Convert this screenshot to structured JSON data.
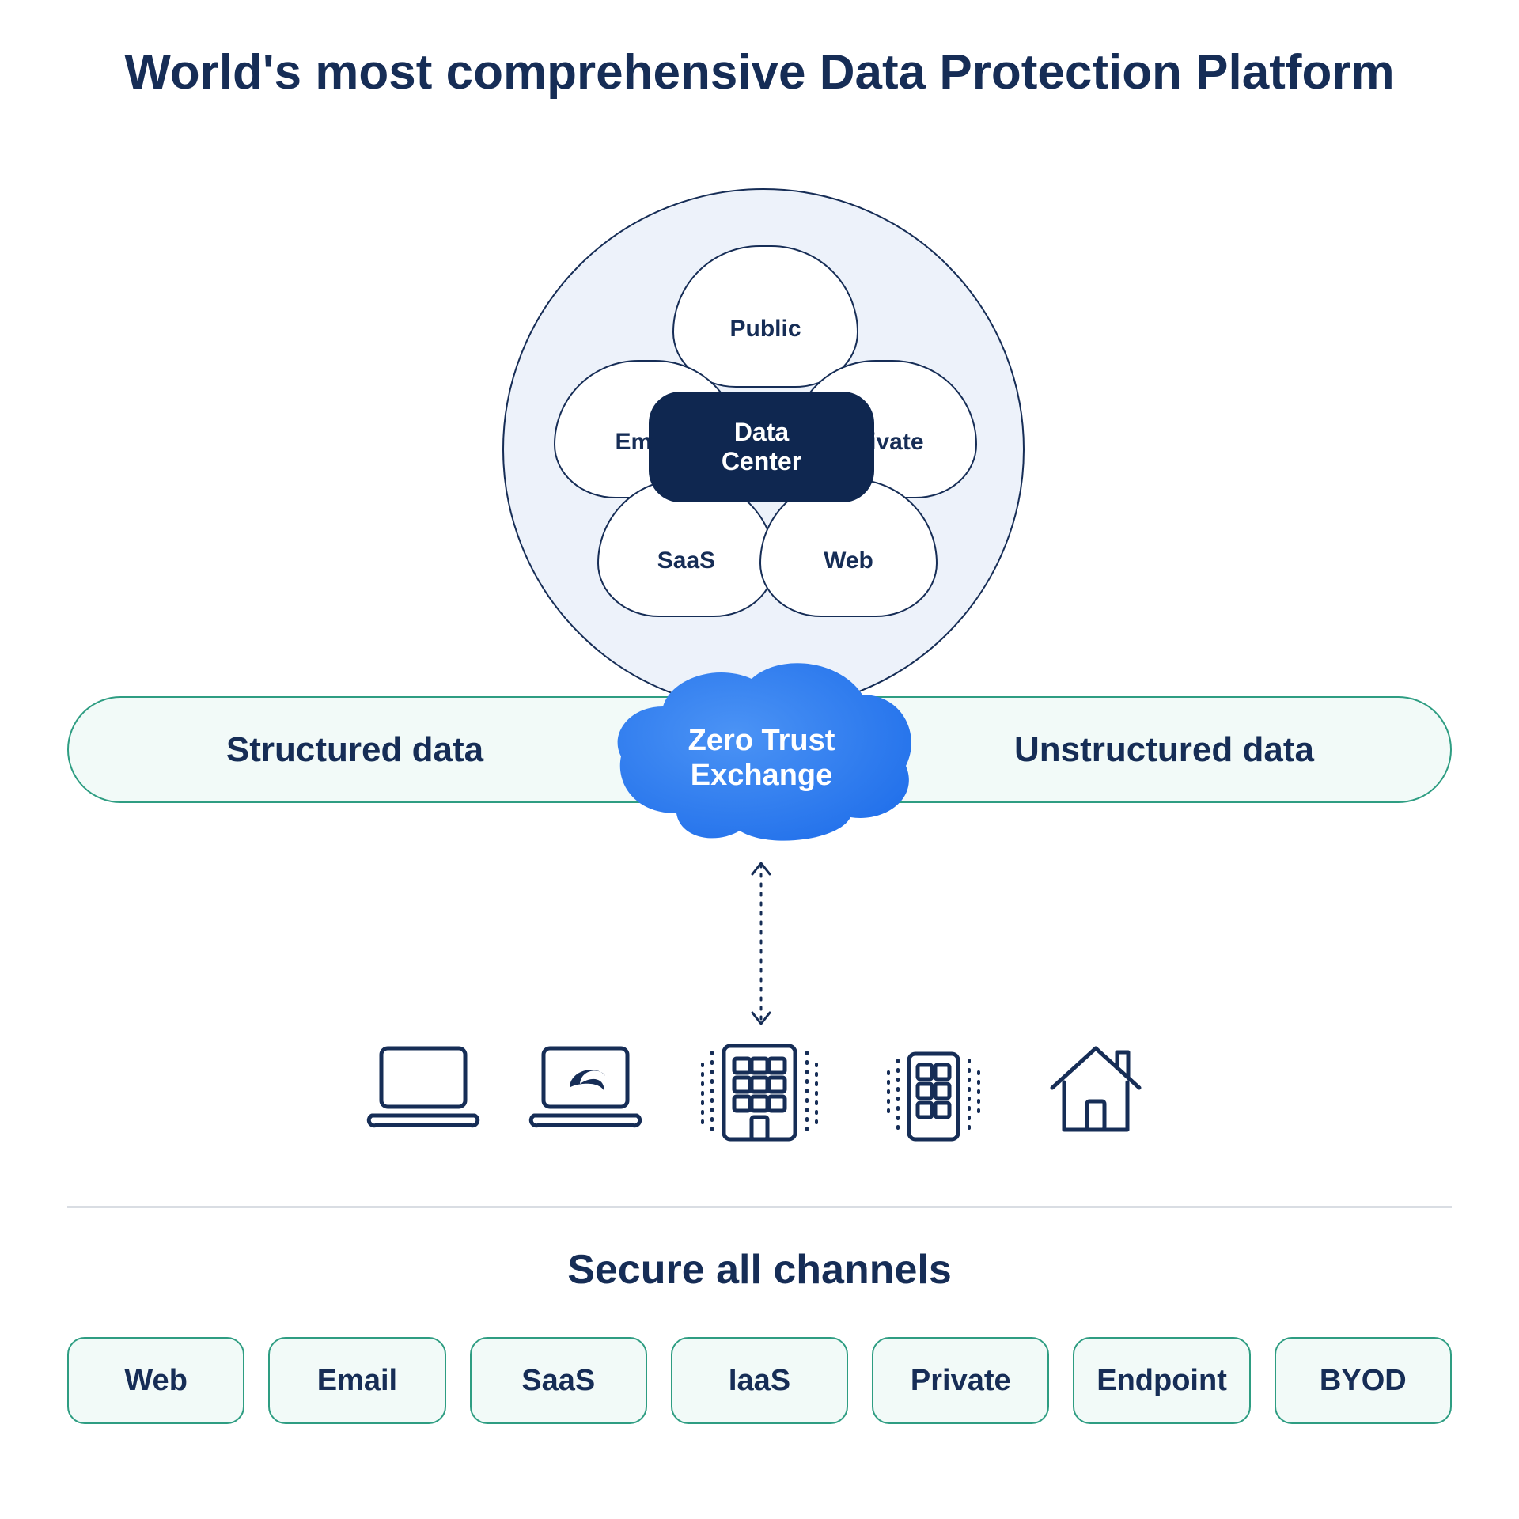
{
  "title": "World's most comprehensive Data Protection Platform",
  "clouds": {
    "public": "Public",
    "email": "Email",
    "private": "Private",
    "saas": "SaaS",
    "web": "Web"
  },
  "data_center": "Data Center",
  "bar": {
    "left": "Structured data",
    "right": "Unstructured data"
  },
  "zte": "Zero Trust Exchange",
  "sub_title": "Secure all channels",
  "channels": [
    "Web",
    "Email",
    "SaaS",
    "IaaS",
    "Private",
    "Endpoint",
    "BYOD"
  ],
  "icons": [
    "laptop-icon",
    "laptop-brand-icon",
    "office-large-icon",
    "office-small-icon",
    "home-icon"
  ]
}
